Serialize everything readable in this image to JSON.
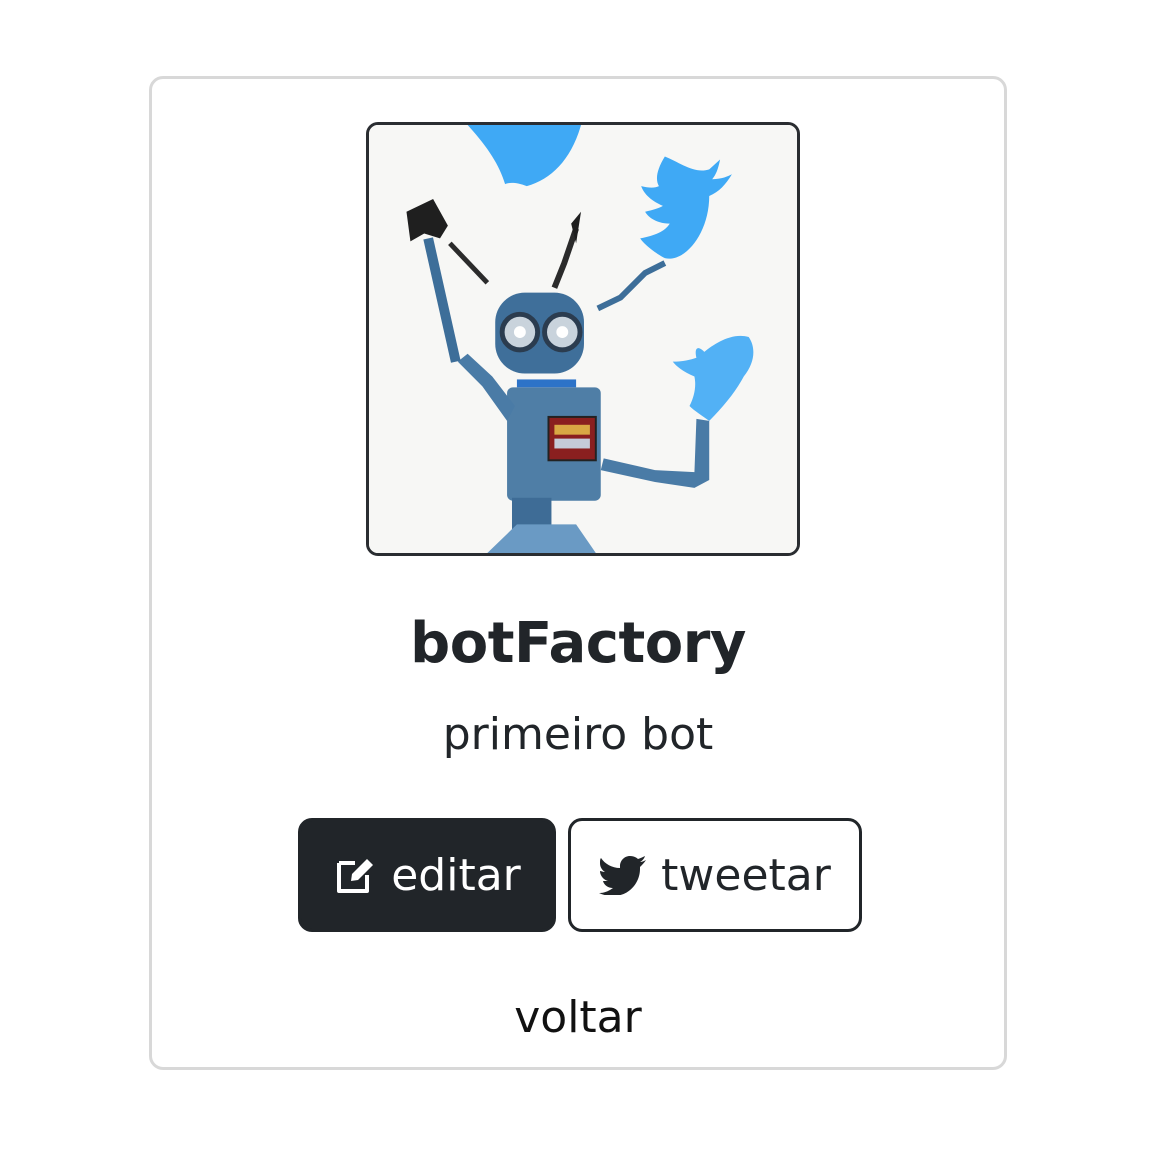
{
  "bot": {
    "name": "botFactory",
    "description": "primeiro bot",
    "avatar_icon": "robot-juggling-twitter-birds-image"
  },
  "actions": {
    "edit_label": "editar",
    "edit_icon": "edit-pencil-icon",
    "tweet_label": "tweetar",
    "tweet_icon": "twitter-bird-icon",
    "back_label": "voltar"
  },
  "colors": {
    "primary_button": "#212529",
    "card_border": "#d8d8d8",
    "twitter_blue": "#3fa9f5"
  }
}
